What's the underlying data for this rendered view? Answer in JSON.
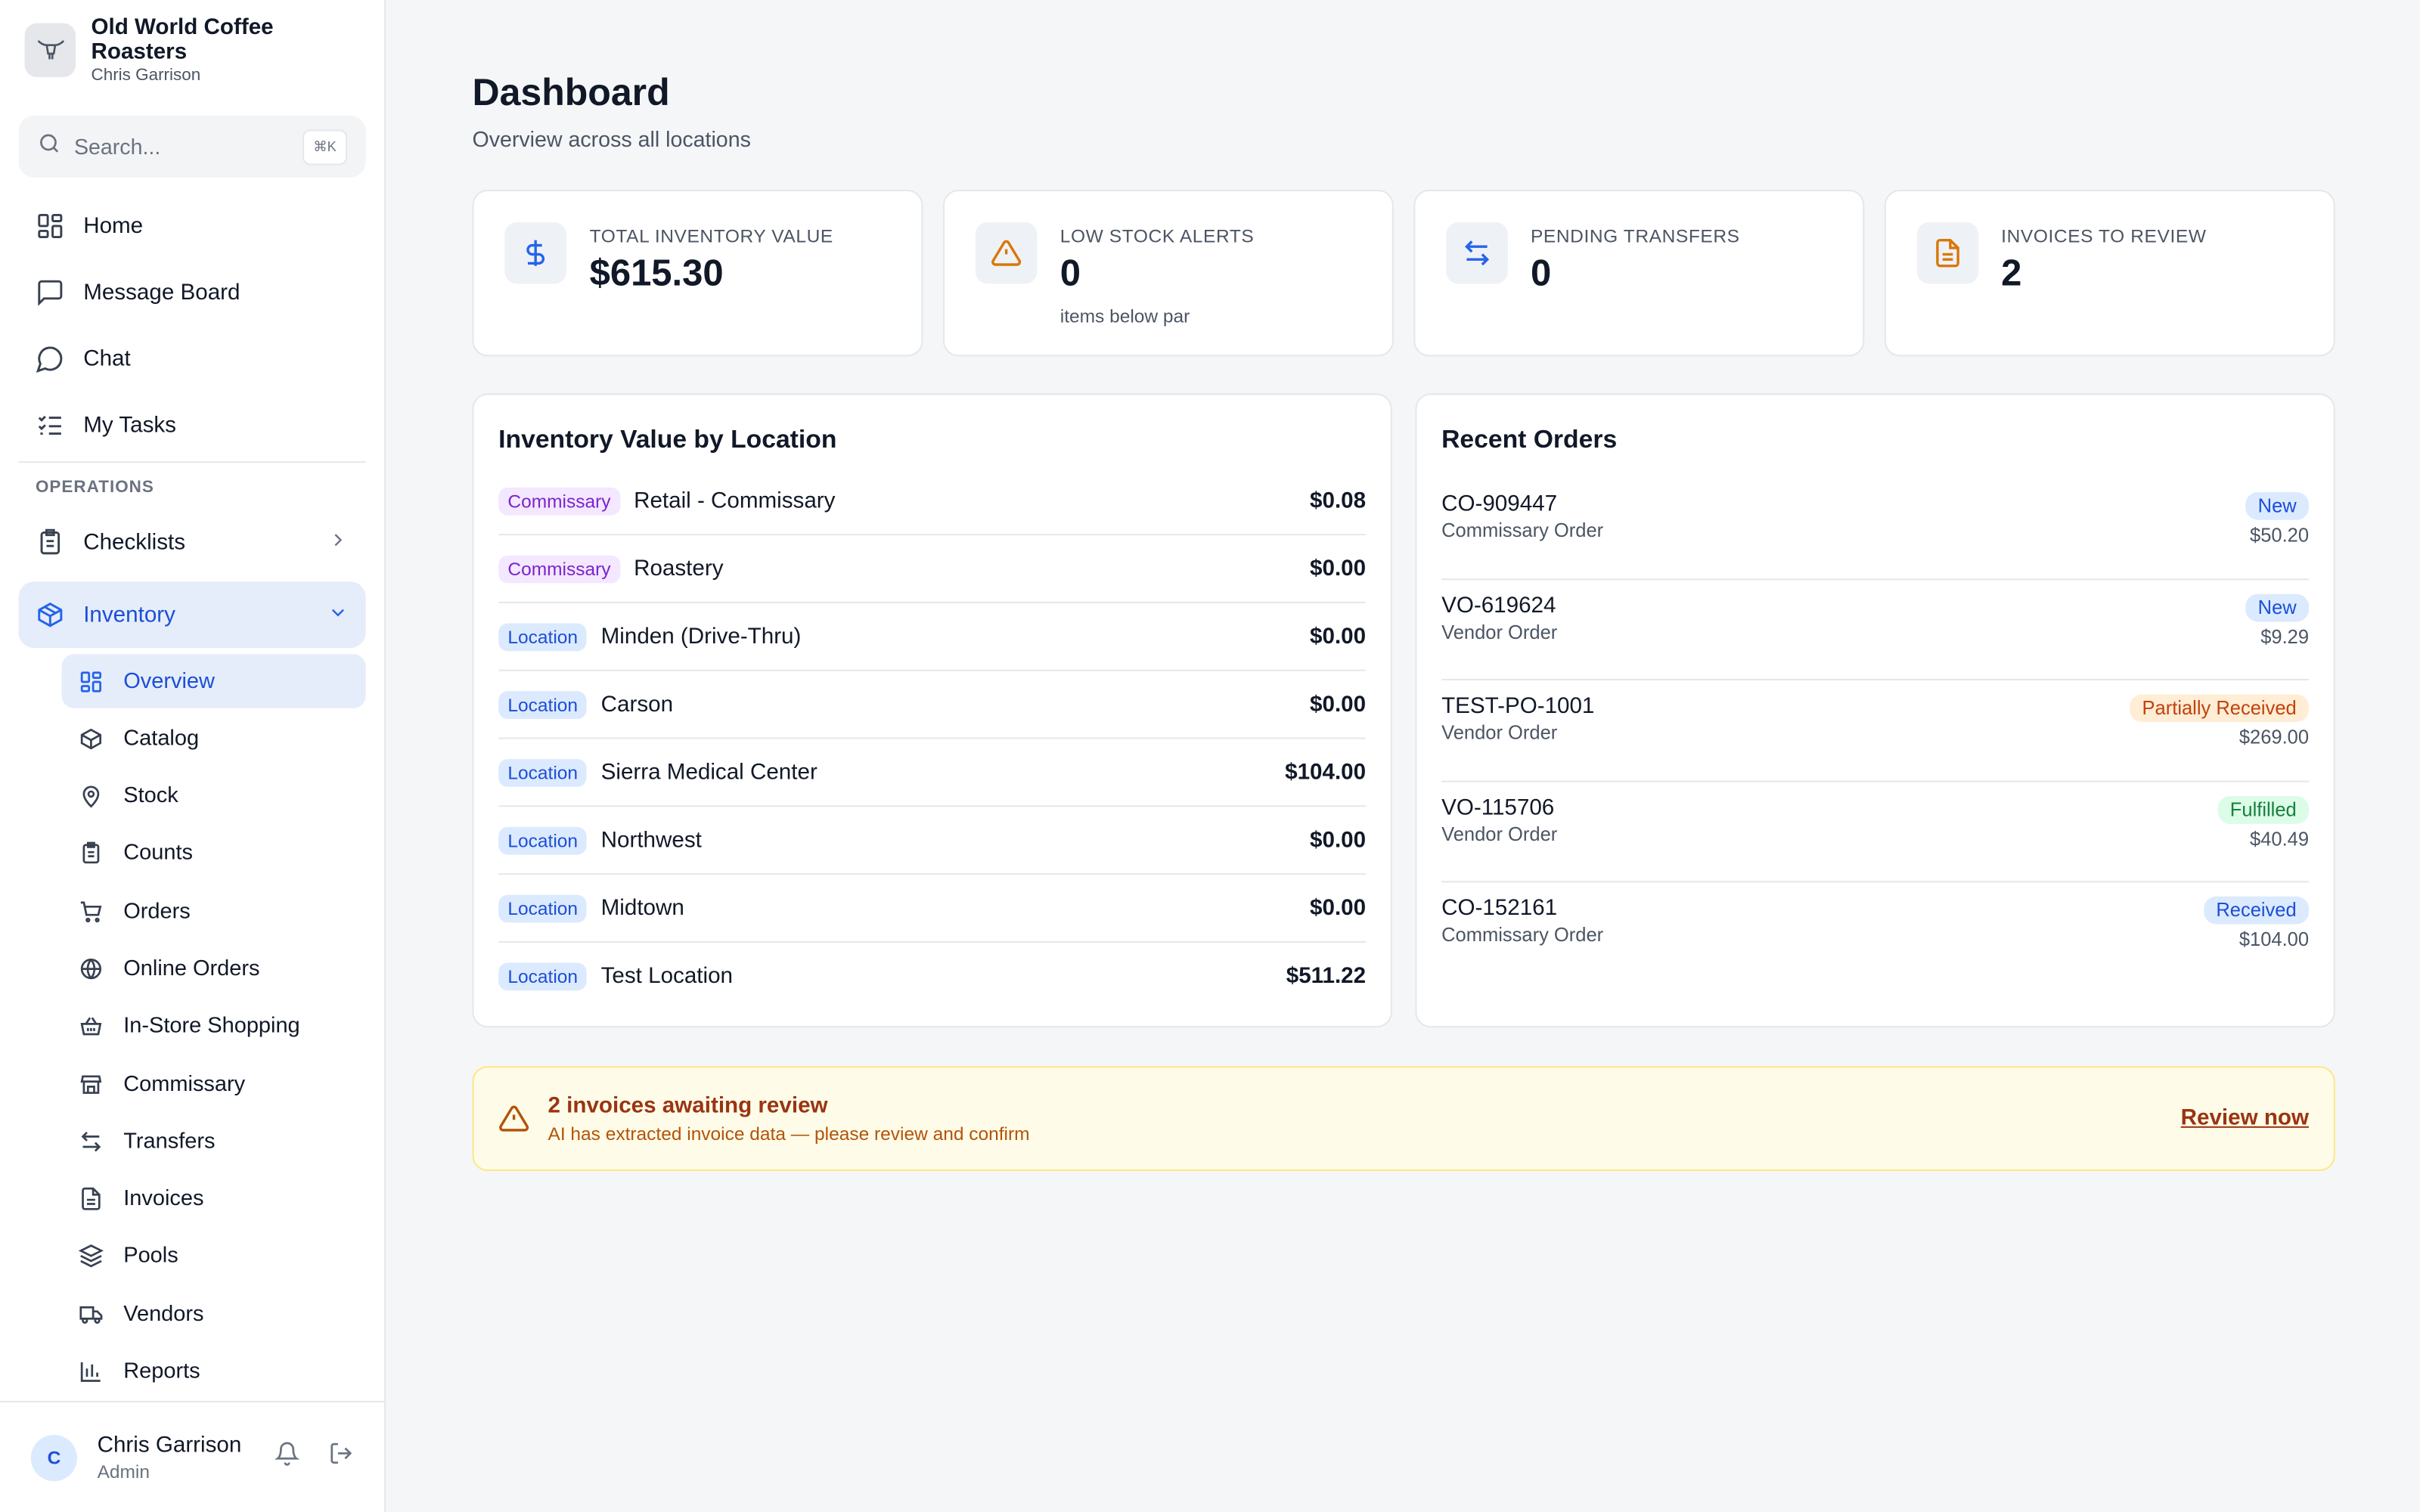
{
  "brand": {
    "name": "Old World Coffee Roasters",
    "user": "Chris Garrison"
  },
  "search": {
    "placeholder": "Search...",
    "shortcut": "⌘K"
  },
  "nav": {
    "main": [
      "Home",
      "Message Board",
      "Chat",
      "My Tasks"
    ],
    "section_label": "OPERATIONS",
    "checklists": "Checklists",
    "inventory": "Inventory",
    "sub": [
      "Overview",
      "Catalog",
      "Stock",
      "Counts",
      "Orders",
      "Online Orders",
      "In-Store Shopping",
      "Commissary",
      "Transfers",
      "Invoices",
      "Pools",
      "Vendors",
      "Reports"
    ]
  },
  "user": {
    "initial": "C",
    "name": "Chris Garrison",
    "role": "Admin"
  },
  "page": {
    "title": "Dashboard",
    "subtitle": "Overview across all locations"
  },
  "stats": [
    {
      "label": "TOTAL INVENTORY VALUE",
      "value": "$615.30",
      "note": ""
    },
    {
      "label": "LOW STOCK ALERTS",
      "value": "0",
      "note": "items below par"
    },
    {
      "label": "PENDING TRANSFERS",
      "value": "0",
      "note": ""
    },
    {
      "label": "INVOICES TO REVIEW",
      "value": "2",
      "note": ""
    }
  ],
  "locations": {
    "title": "Inventory Value by Location",
    "rows": [
      {
        "tag": "Commissary",
        "name": "Retail - Commissary",
        "value": "$0.08"
      },
      {
        "tag": "Commissary",
        "name": "Roastery",
        "value": "$0.00"
      },
      {
        "tag": "Location",
        "name": "Minden (Drive-Thru)",
        "value": "$0.00"
      },
      {
        "tag": "Location",
        "name": "Carson",
        "value": "$0.00"
      },
      {
        "tag": "Location",
        "name": "Sierra Medical Center",
        "value": "$104.00"
      },
      {
        "tag": "Location",
        "name": "Northwest",
        "value": "$0.00"
      },
      {
        "tag": "Location",
        "name": "Midtown",
        "value": "$0.00"
      },
      {
        "tag": "Location",
        "name": "Test Location",
        "value": "$511.22"
      }
    ]
  },
  "orders": {
    "title": "Recent Orders",
    "rows": [
      {
        "id": "CO-909447",
        "type": "Commissary Order",
        "status": "New",
        "amount": "$50.20"
      },
      {
        "id": "VO-619624",
        "type": "Vendor Order",
        "status": "New",
        "amount": "$9.29"
      },
      {
        "id": "TEST-PO-1001",
        "type": "Vendor Order",
        "status": "Partially Received",
        "amount": "$269.00"
      },
      {
        "id": "VO-115706",
        "type": "Vendor Order",
        "status": "Fulfilled",
        "amount": "$40.49"
      },
      {
        "id": "CO-152161",
        "type": "Commissary Order",
        "status": "Received",
        "amount": "$104.00"
      }
    ]
  },
  "alert": {
    "title": "2 invoices awaiting review",
    "subtitle": "AI has extracted invoice data — please review and confirm",
    "link": "Review now"
  },
  "colors": {
    "accent": "#2563eb",
    "warning": "#d97706",
    "alert_bg": "#fefce8"
  }
}
